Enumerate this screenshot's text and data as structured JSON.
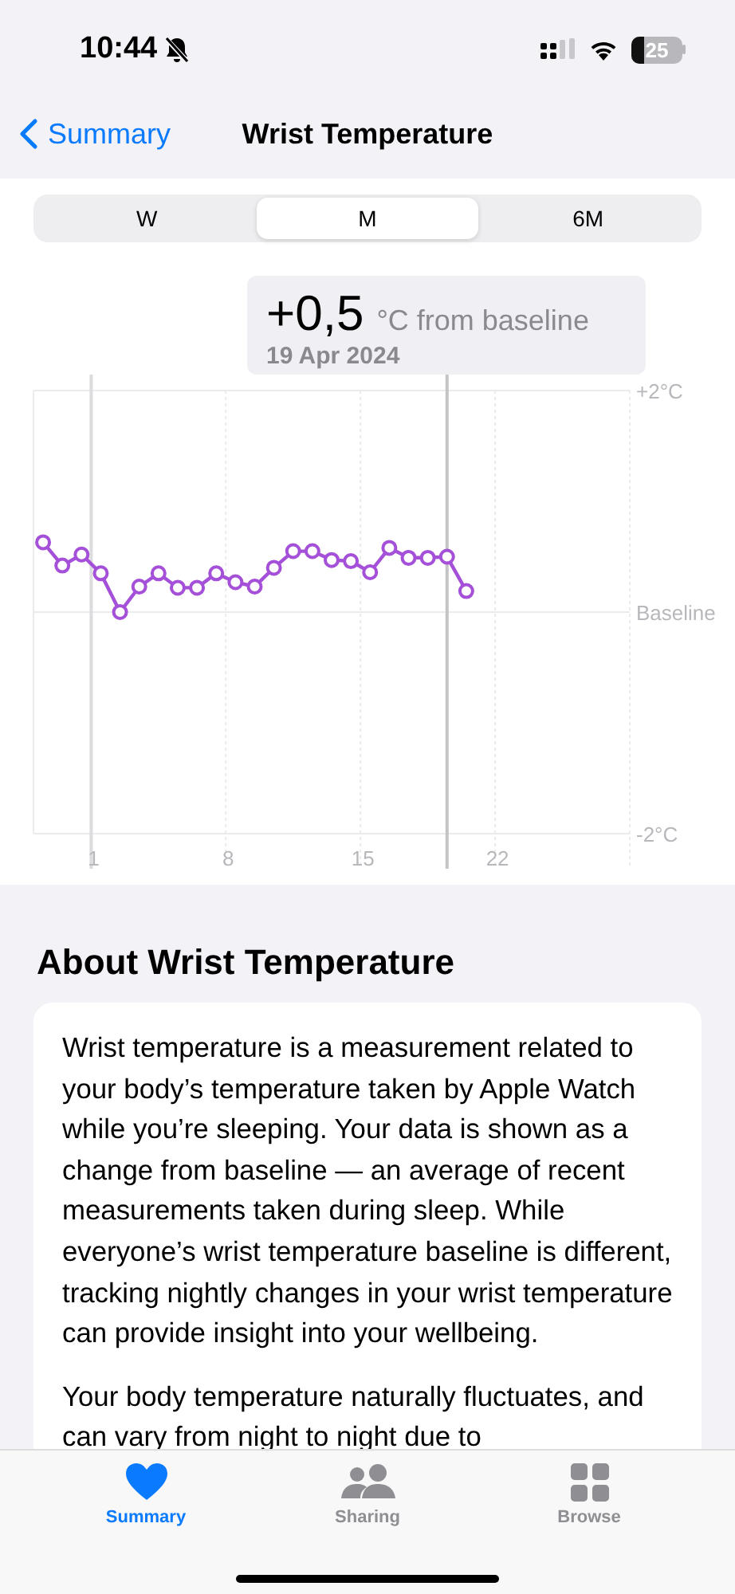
{
  "status_bar": {
    "time": "10:44",
    "battery": "25"
  },
  "nav": {
    "back": "Summary",
    "title": "Wrist Temperature"
  },
  "segments": [
    {
      "label": "W",
      "selected": false
    },
    {
      "label": "M",
      "selected": true
    },
    {
      "label": "6M",
      "selected": false
    }
  ],
  "tooltip": {
    "value": "+0,5",
    "unit": "°C from baseline",
    "date": "19 Apr 2024"
  },
  "chart_data": {
    "type": "line",
    "x": [
      -1.5,
      -0.5,
      0.5,
      1.5,
      2.5,
      3.5,
      4.5,
      5.5,
      6.5,
      7.5,
      8.5,
      9.5,
      10.5,
      11.5,
      12.5,
      13.5,
      14.5,
      15.5,
      16.5,
      17.5,
      18.5,
      19.5,
      20.5
    ],
    "series": [
      {
        "color": "#a550d8",
        "marker": "o",
        "values": [
          0.63,
          0.42,
          0.52,
          0.35,
          0.0,
          0.23,
          0.35,
          0.22,
          0.22,
          0.35,
          0.27,
          0.23,
          0.4,
          0.55,
          0.55,
          0.47,
          0.46,
          0.36,
          0.58,
          0.49,
          0.49,
          0.5,
          0.19
        ]
      }
    ],
    "xlim": [
      -2,
      29
    ],
    "grid": true,
    "ref_lines": [
      {
        "axis": "x",
        "value": 1,
        "color": "#dcdcde"
      },
      {
        "axis": "x",
        "value": 19.5,
        "color": "#c4c4c6"
      }
    ],
    "ylim": [
      -2,
      2
    ],
    "xticks": [
      1,
      8,
      15,
      22
    ],
    "yticks": [
      {
        "value": 2,
        "label": "+2°C"
      },
      {
        "value": 0,
        "label": "Baseline"
      },
      {
        "value": -2,
        "label": "-2°C"
      }
    ]
  },
  "about": {
    "heading": "About Wrist Temperature",
    "paragraphs": [
      "Wrist temperature is a measurement related to your body’s temperature taken by Apple Watch while you’re sleeping. Your data is shown as a change from baseline — an average of recent measurements taken during sleep. While everyone’s wrist temperature baseline is different, tracking nightly changes in your wrist temperature can provide insight into your wellbeing.",
      "Your body temperature naturally fluctuates, and can vary from night to night due to"
    ]
  },
  "tab_bar": [
    {
      "kind": "heart",
      "label": "Summary",
      "selected": true
    },
    {
      "kind": "people",
      "label": "Sharing",
      "selected": false
    },
    {
      "kind": "grid",
      "label": "Browse",
      "selected": false
    }
  ]
}
